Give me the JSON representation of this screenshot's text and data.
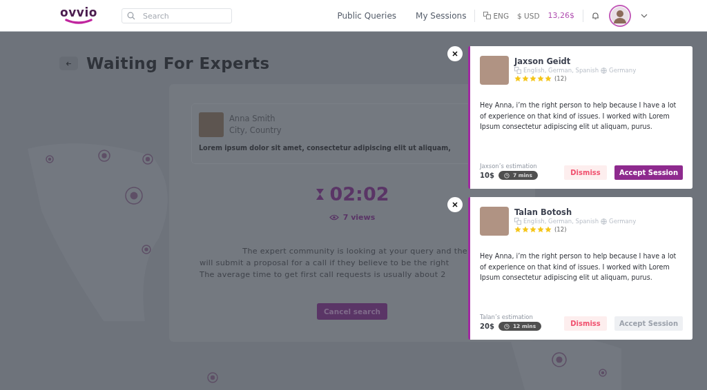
{
  "header": {
    "logo": "ovvio",
    "search": {
      "placeholder": "Search"
    },
    "nav": [
      {
        "label": "Public Queries"
      },
      {
        "label": "My Sessions"
      }
    ],
    "language": "ENG",
    "currency": "$ USD",
    "balance": "13,26$"
  },
  "page": {
    "title": "Waiting For Experts"
  },
  "query": {
    "name": "Anna Smith",
    "location": "City, Country",
    "text": "Lorem ipsum dolor sit amet, consectetur adipiscing elit ut aliquam,",
    "timer": "02:02",
    "views": "7 views",
    "info_lines": [
      "The expert community is looking at your query and the",
      "will submit a proposal for a call if they believe to be the right",
      "The average time to get first call requests is usually about 2"
    ],
    "cancel": "Cancel search"
  },
  "offers": [
    {
      "name": "Jaxson Geidt",
      "languages": "English, German, Spanish",
      "country": "Germany",
      "stars": 5,
      "reviews": "(12)",
      "message": "Hey Anna, i’m the right person to help because I have a lot of experience on that kind of issues. I worked with Lorem Ipsum consectetur adipiscing elit ut aliquam, purus.",
      "estimation_label": "Jaxson’s estimation",
      "price": "10$",
      "duration": "7 mins",
      "dismiss": "Dismiss",
      "accept": "Accept Session",
      "disabled": false
    },
    {
      "name": "Talan Botosh",
      "languages": "English, German, Spanish",
      "country": "Germany",
      "stars": 5,
      "reviews": "(12)",
      "message": "Hey Anna, i’m the right person to help because I have a lot of experience on that kind of issues. I worked with Lorem Ipsum consectetur adipiscing elit ut aliquam, purus.",
      "estimation_label": "Talan’s estimation",
      "price": "20$",
      "duration": "12 mins",
      "dismiss": "Dismiss",
      "accept": "Accept Session",
      "disabled": true
    }
  ]
}
